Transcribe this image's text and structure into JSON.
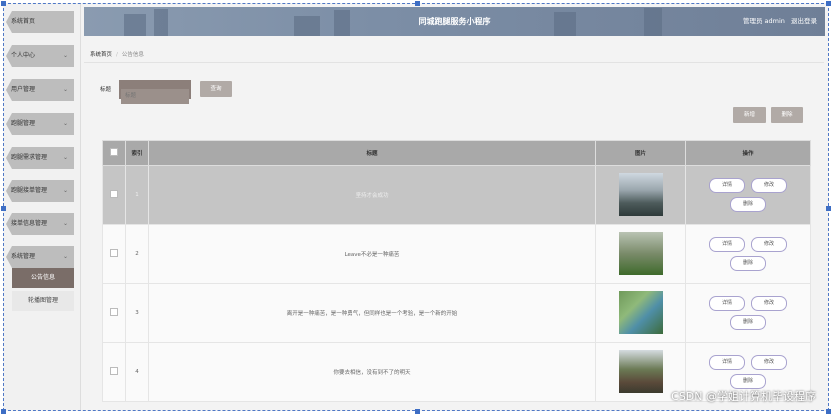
{
  "header": {
    "title": "同城跑腿服务小程序",
    "user_label": "管理员 admin",
    "logout": "退出登录"
  },
  "sidebar": {
    "items": [
      {
        "label": "系统首页",
        "chevron": ""
      },
      {
        "label": "个人中心",
        "chevron": "⌄"
      },
      {
        "label": "用户管理",
        "chevron": "⌄"
      },
      {
        "label": "跑腿管理",
        "chevron": "⌄"
      },
      {
        "label": "跑腿需求管理",
        "chevron": "⌄"
      },
      {
        "label": "跑腿接单管理",
        "chevron": "⌄"
      },
      {
        "label": "接单信息管理",
        "chevron": "⌄"
      },
      {
        "label": "系统管理",
        "chevron": "⌄"
      }
    ],
    "subitems": [
      {
        "label": "公告信息"
      },
      {
        "label": "轮播图管理"
      }
    ]
  },
  "breadcrumb": {
    "home": "系统首页",
    "sep": "/",
    "current": "公告信息"
  },
  "search": {
    "label": "标题",
    "placeholder": "标题",
    "button": "查询"
  },
  "toolbar": {
    "add": "新增",
    "delete": "删除"
  },
  "table": {
    "columns": [
      "",
      "索引",
      "标题",
      "图片",
      "操作"
    ],
    "actions": {
      "detail": "详情",
      "edit": "修改",
      "delete": "删除"
    },
    "rows": [
      {
        "index": "1",
        "title": "坚持才会成功"
      },
      {
        "index": "2",
        "title": "Leave不必是一种痛苦"
      },
      {
        "index": "3",
        "title": "离开是一种痛苦，是一种勇气，但同样也是一个考验，是一个新的开始"
      },
      {
        "index": "4",
        "title": "你要去相信，没有到不了的明天"
      }
    ]
  },
  "watermark": "CSDN @学姐计算机毕设程序"
}
